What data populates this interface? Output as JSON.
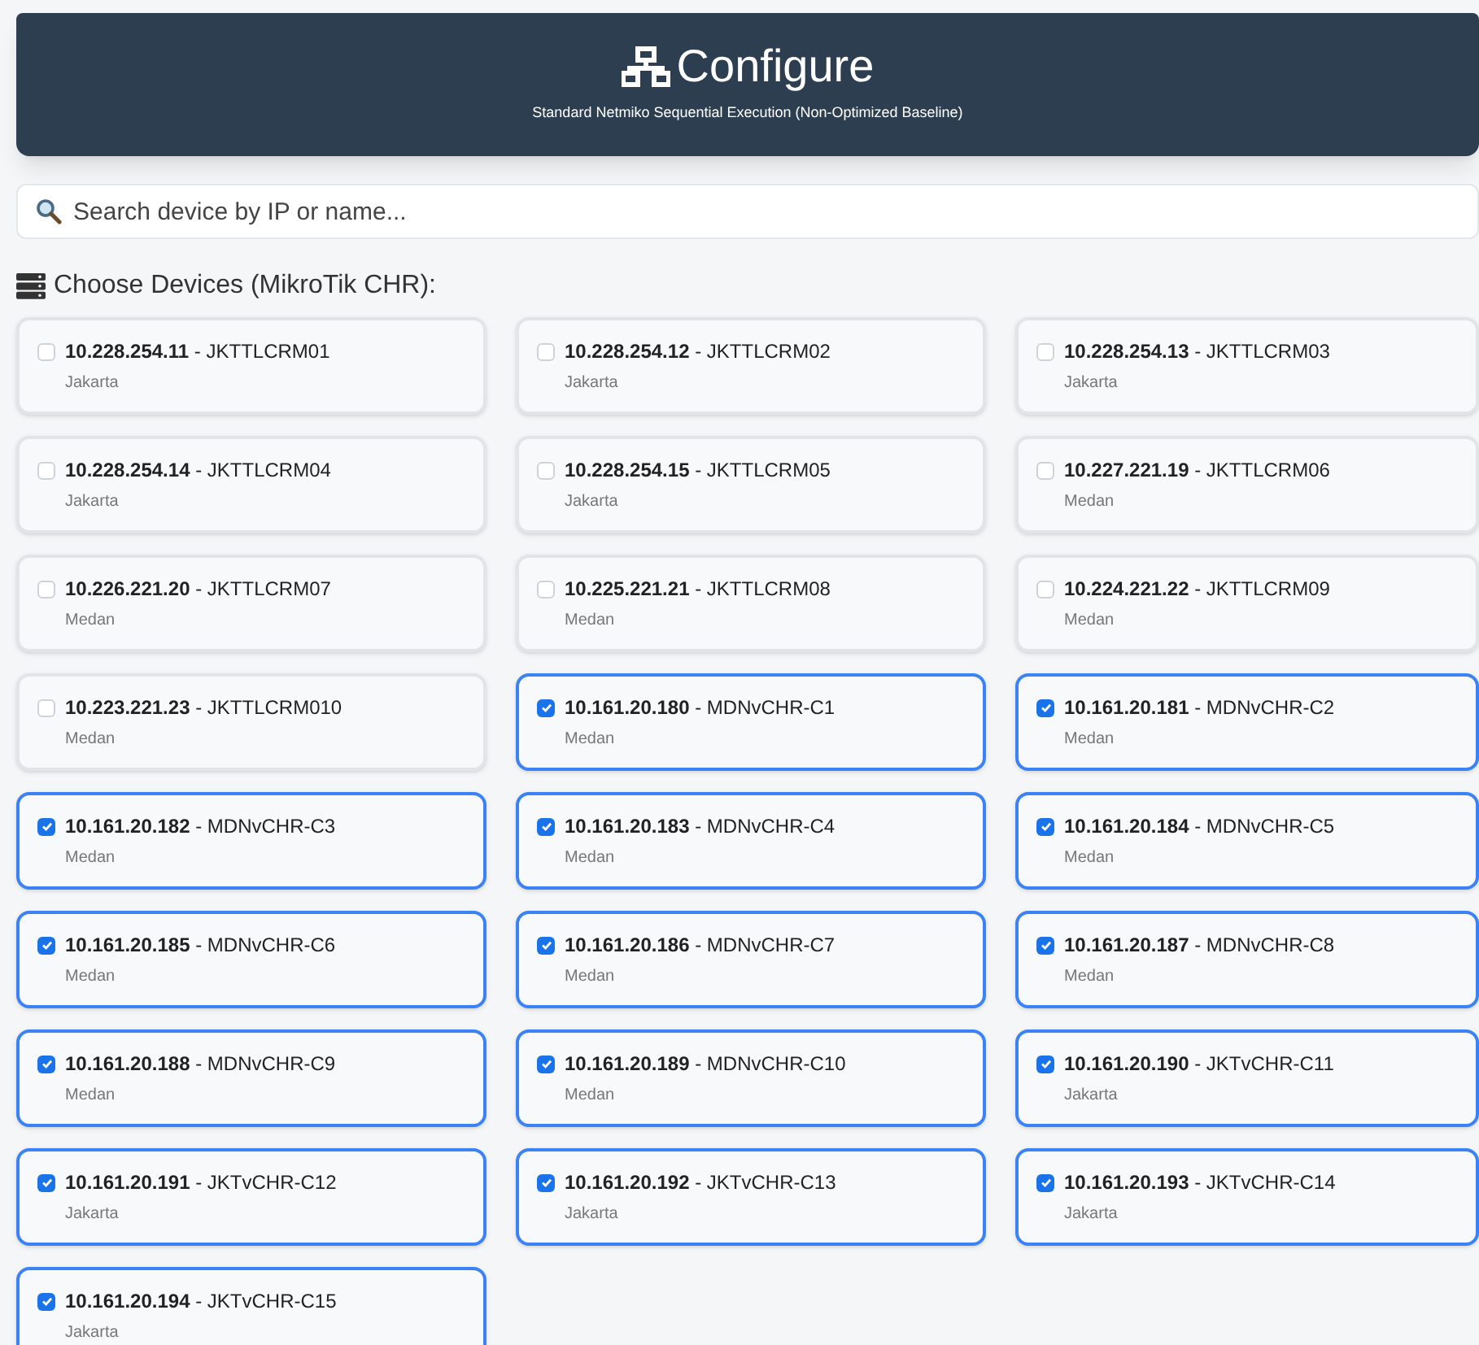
{
  "header": {
    "title": "Configure",
    "subtitle": "Standard Netmiko Sequential Execution (Non-Optimized Baseline)"
  },
  "search": {
    "placeholder": "Search device by IP or name..."
  },
  "section_title": "Choose Devices (MikroTik CHR):",
  "devices": [
    {
      "label": "**10.228.254.11** - JKTTLCRM01",
      "location": "Jakarta",
      "checked": false
    },
    {
      "label": "**10.228.254.12** - JKTTLCRM02",
      "location": "Jakarta",
      "checked": false
    },
    {
      "label": "**10.228.254.13** - JKTTLCRM03",
      "location": "Jakarta",
      "checked": false
    },
    {
      "label": "**10.228.254.14** - JKTTLCRM04",
      "location": "Jakarta",
      "checked": false
    },
    {
      "label": "**10.228.254.15** - JKTTLCRM05",
      "location": "Jakarta",
      "checked": false
    },
    {
      "label": "**10.227.221.19** - JKTTLCRM06",
      "location": "Medan",
      "checked": false
    },
    {
      "label": "**10.226.221.20** - JKTTLCRM07",
      "location": "Medan",
      "checked": false
    },
    {
      "label": "**10.225.221.21** - JKTTLCRM08",
      "location": "Medan",
      "checked": false
    },
    {
      "label": "**10.224.221.22** - JKTTLCRM09",
      "location": "Medan",
      "checked": false
    },
    {
      "label": "**10.223.221.23** - JKTTLCRM010",
      "location": "Medan",
      "checked": false
    },
    {
      "label": "**10.161.20.180** - MDNvCHR-C1",
      "location": "Medan",
      "checked": true
    },
    {
      "label": "**10.161.20.181** - MDNvCHR-C2",
      "location": "Medan",
      "checked": true
    },
    {
      "label": "**10.161.20.182** - MDNvCHR-C3",
      "location": "Medan",
      "checked": true
    },
    {
      "label": "**10.161.20.183** - MDNvCHR-C4",
      "location": "Medan",
      "checked": true
    },
    {
      "label": "**10.161.20.184** - MDNvCHR-C5",
      "location": "Medan",
      "checked": true
    },
    {
      "label": "**10.161.20.185** - MDNvCHR-C6",
      "location": "Medan",
      "checked": true
    },
    {
      "label": "**10.161.20.186** - MDNvCHR-C7",
      "location": "Medan",
      "checked": true
    },
    {
      "label": "**10.161.20.187** - MDNvCHR-C8",
      "location": "Medan",
      "checked": true
    },
    {
      "label": "**10.161.20.188** - MDNvCHR-C9",
      "location": "Medan",
      "checked": true
    },
    {
      "label": "**10.161.20.189** - MDNvCHR-C10",
      "location": "Medan",
      "checked": true
    },
    {
      "label": "**10.161.20.190** - JKTvCHR-C11",
      "location": "Jakarta",
      "checked": true
    },
    {
      "label": "**10.161.20.191** - JKTvCHR-C12",
      "location": "Jakarta",
      "checked": true
    },
    {
      "label": "**10.161.20.192** - JKTvCHR-C13",
      "location": "Jakarta",
      "checked": true
    },
    {
      "label": "**10.161.20.193** - JKTvCHR-C14",
      "location": "Jakarta",
      "checked": true
    },
    {
      "label": "**10.161.20.194** - JKTvCHR-C15",
      "location": "Jakarta",
      "checked": true
    }
  ]
}
